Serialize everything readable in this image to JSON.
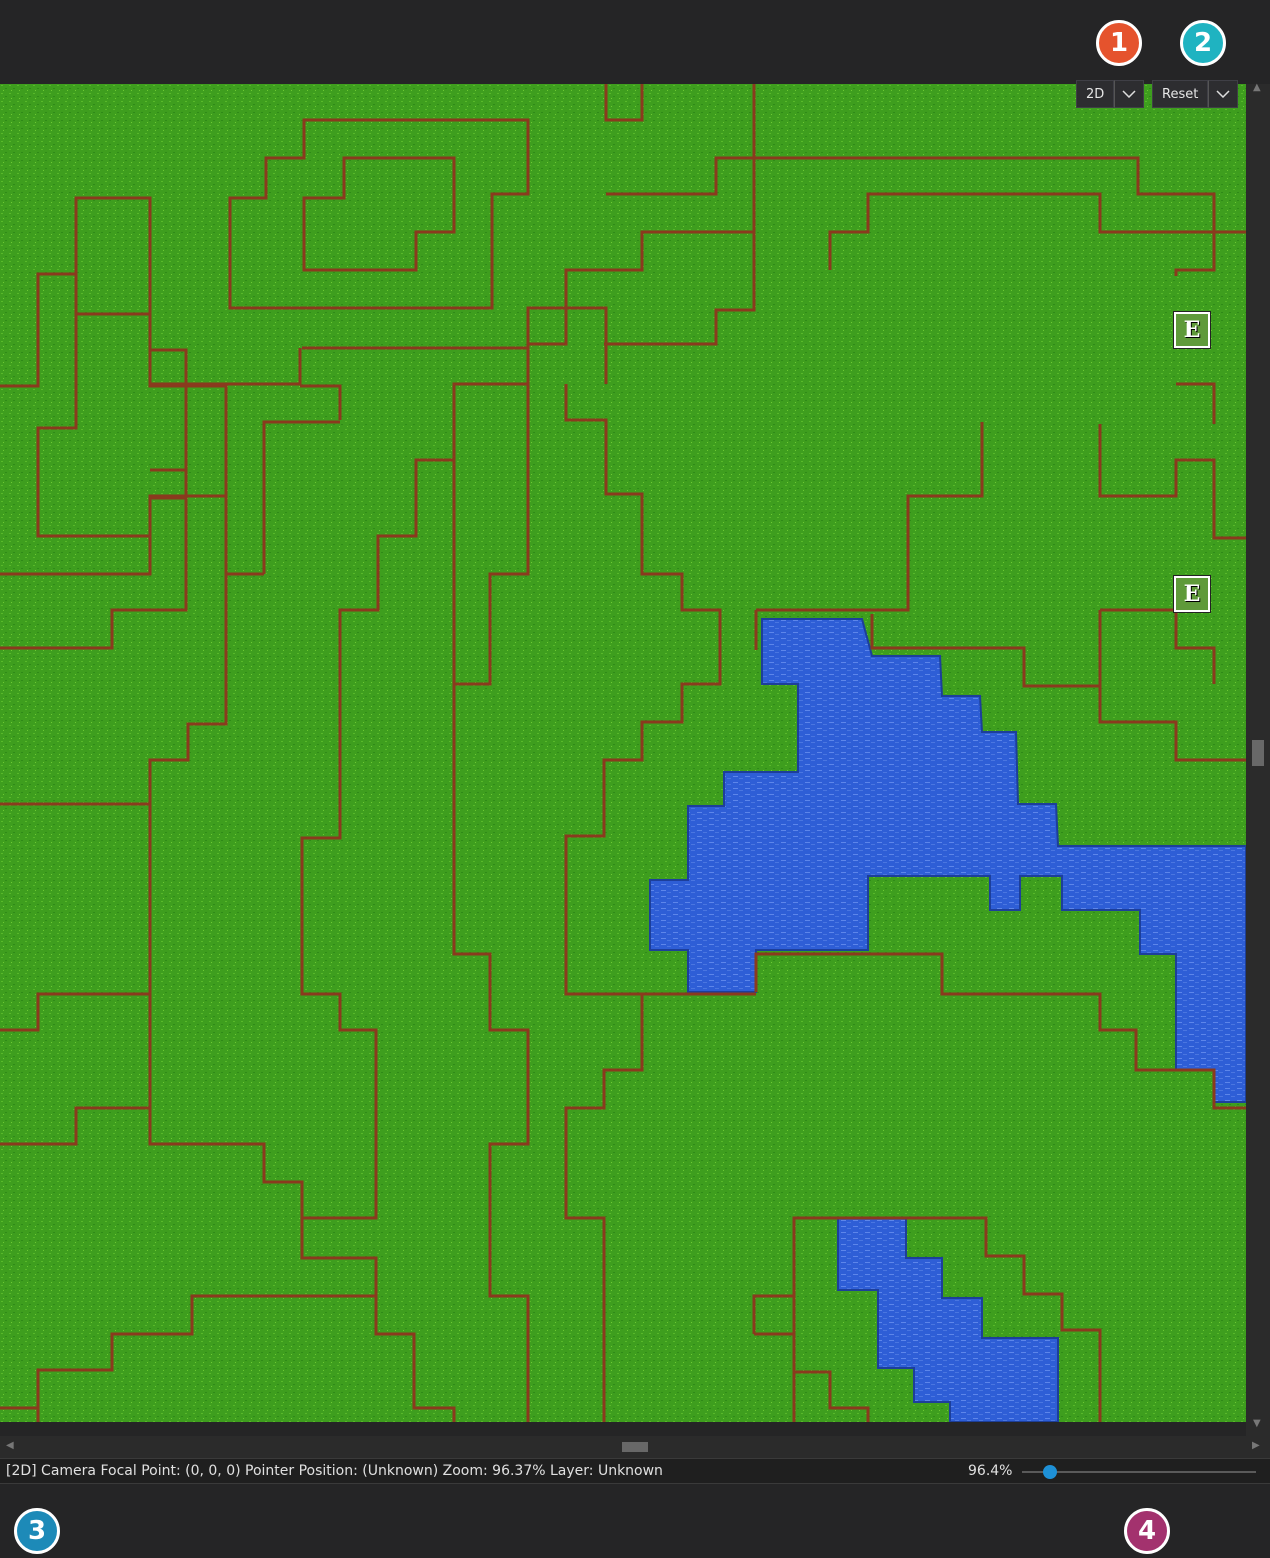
{
  "toolbar": {
    "view_mode_label": "2D",
    "reset_label": "Reset"
  },
  "annotations": {
    "badge_1": "1",
    "badge_2": "2",
    "badge_3": "3",
    "badge_4": "4"
  },
  "map": {
    "entity_markers": [
      {
        "label": "E"
      },
      {
        "label": "E"
      }
    ],
    "colors": {
      "grass": "#3e9e1e",
      "water": "#2e5ed6",
      "cliff": "#8a3a1e"
    }
  },
  "statusbar": {
    "text": "[2D] Camera Focal Point: (0, 0, 0) Pointer Position: (Unknown) Zoom: 96.37% Layer: Unknown",
    "zoom_value": "96.4%",
    "zoom_level": 96.4
  },
  "colors": {
    "badge_1": "#e5532d",
    "badge_2": "#1fb3c1",
    "badge_3": "#1d8ab8",
    "badge_4": "#a3326e",
    "slider_accent": "#1e90d6"
  }
}
